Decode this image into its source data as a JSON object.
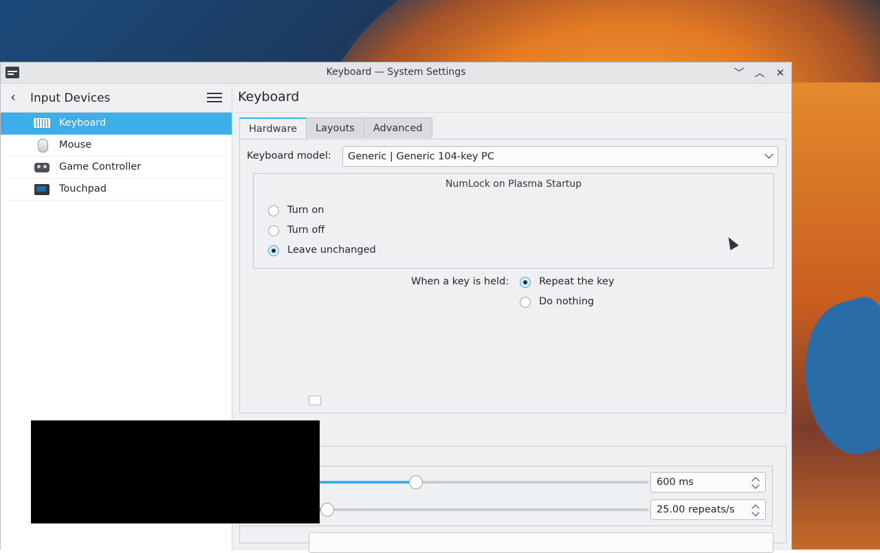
{
  "window": {
    "title": "Keyboard — System Settings",
    "controls": {
      "minimize": "﹀",
      "maximize": "︿",
      "close": "✕"
    }
  },
  "sidebar": {
    "back_icon": "‹",
    "heading": "Input Devices",
    "items": [
      {
        "label": "Keyboard",
        "icon": "keyboard-icon",
        "active": true
      },
      {
        "label": "Mouse",
        "icon": "mouse-icon",
        "active": false
      },
      {
        "label": "Game Controller",
        "icon": "gamepad-icon",
        "active": false
      },
      {
        "label": "Touchpad",
        "icon": "touchpad-icon",
        "active": false
      }
    ]
  },
  "main": {
    "title": "Keyboard",
    "tabs": [
      {
        "label": "Hardware",
        "active": true
      },
      {
        "label": "Layouts",
        "active": false
      },
      {
        "label": "Advanced",
        "active": false
      }
    ],
    "keyboard_model": {
      "label": "Keyboard model:",
      "value": "Generic | Generic 104-key PC"
    },
    "numlock": {
      "title": "NumLock on Plasma Startup",
      "options": [
        {
          "label": "Turn on",
          "selected": false
        },
        {
          "label": "Turn off",
          "selected": false
        },
        {
          "label": "Leave unchanged",
          "selected": true
        }
      ]
    },
    "key_held": {
      "label": "When a key is held:",
      "options": [
        {
          "label": "Repeat the key",
          "selected": true
        },
        {
          "label": "Do nothing",
          "selected": false
        }
      ]
    },
    "delay": {
      "value_text": "600 ms",
      "fraction": 0.42
    },
    "rate": {
      "value_text": "25.00 repeats/s",
      "fraction": 0.2
    }
  },
  "colors": {
    "accent": "#3daee9",
    "window_bg": "#eff0f1",
    "text": "#232629"
  }
}
